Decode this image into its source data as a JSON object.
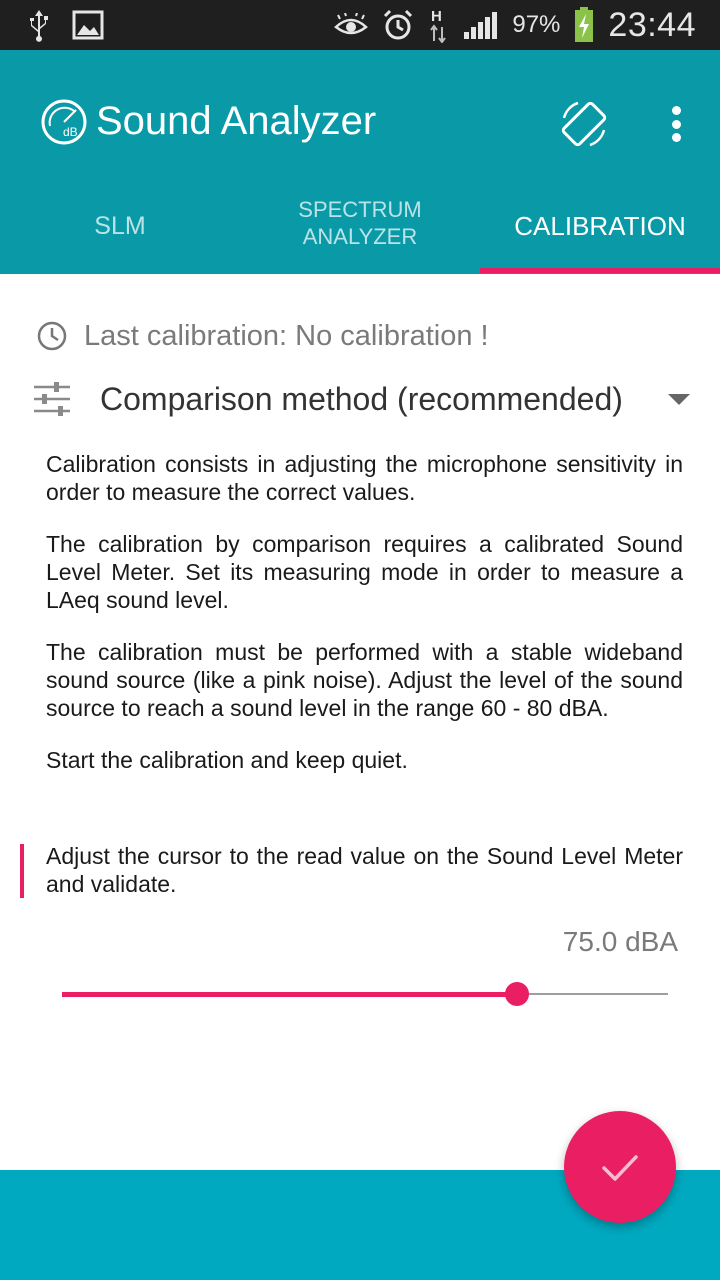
{
  "status_bar": {
    "battery_percent": "97%",
    "time": "23:44",
    "network_type": "H",
    "icons": [
      "usb-icon",
      "image-icon",
      "eye-icon",
      "alarm-icon",
      "data-arrows-icon",
      "signal-icon",
      "battery-charging-icon"
    ]
  },
  "app_bar": {
    "title": "Sound Analyzer",
    "logo_text": "dB",
    "logo_icon": "db-gauge-icon",
    "actions": [
      "screen-rotation-icon",
      "more-vert-icon"
    ]
  },
  "tabs": [
    {
      "label": "SLM",
      "active": false
    },
    {
      "label": "SPECTRUM\nANALYZER",
      "active": false
    },
    {
      "label": "CALIBRATION",
      "active": true
    }
  ],
  "calibration": {
    "last_calibration": "Last calibration: No calibration !",
    "method": "Comparison method (recommended)",
    "paragraphs": [
      "Calibration consists in adjusting the microphone sensitivity in order to measure the correct values.",
      "The calibration by comparison requires a calibrated Sound Level Meter. Set its measuring mode in order to measure a LAeq sound level.",
      "The calibration must be performed with a stable wideband sound source (like a pink noise). Adjust the level of the sound source to reach a sound level in the range 60 - 80 dBA.",
      "Start the calibration and keep quiet."
    ],
    "instruction": "Adjust the cursor to the read value on the Sound Level Meter and validate.",
    "value": "75.0 dBA",
    "slider_fraction": 0.75
  },
  "colors": {
    "primary": "#0a9aa7",
    "accent": "#e91e63",
    "status_bar": "#1f1f1f",
    "bottom_band": "#00a9c0"
  },
  "fab": {
    "icon": "check-icon"
  }
}
